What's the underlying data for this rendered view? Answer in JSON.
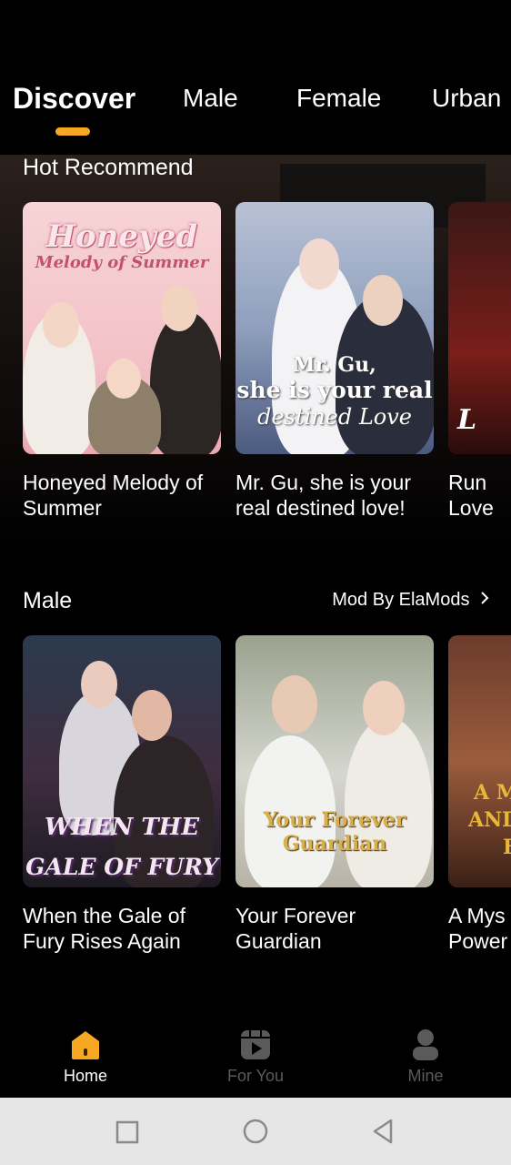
{
  "tabs": [
    {
      "label": "Discover",
      "active": true
    },
    {
      "label": "Male",
      "active": false
    },
    {
      "label": "Female",
      "active": false
    },
    {
      "label": "Urban",
      "active": false
    }
  ],
  "hot": {
    "title": "Hot Recommend",
    "items": [
      {
        "title": "Honeyed Melody of Summer",
        "cover_line1": "Honeyed",
        "cover_line2": "Melody of Summer"
      },
      {
        "title": "Mr. Gu, she is your real destined love!",
        "cover_line1": "Mr. Gu,",
        "cover_line2": "she is your real",
        "cover_line3": "destined Love"
      },
      {
        "title": "Run Love",
        "cover_line1": "L"
      }
    ]
  },
  "male": {
    "title": "Male",
    "more_label": "Mod By ElaMods",
    "items": [
      {
        "title": "When the Gale of Fury Rises Again",
        "cover_line1": "WHEN THE",
        "cover_line2": "GALE OF FURY"
      },
      {
        "title": "Your Forever Guardian",
        "cover_line1": "Your Forever",
        "cover_line2": "Guardian"
      },
      {
        "title": "A Mys Power",
        "cover_line1": "A M",
        "cover_line2": "AND",
        "cover_line3": "H"
      }
    ]
  },
  "nav": {
    "items": [
      {
        "label": "Home",
        "icon": "home-icon",
        "active": true
      },
      {
        "label": "For You",
        "icon": "play-icon",
        "active": false
      },
      {
        "label": "Mine",
        "icon": "profile-icon",
        "active": false
      }
    ]
  },
  "colors": {
    "accent": "#f6a823",
    "inactive": "#5a5a5a",
    "background": "#000000",
    "system_bar": "#e6e6e6"
  }
}
